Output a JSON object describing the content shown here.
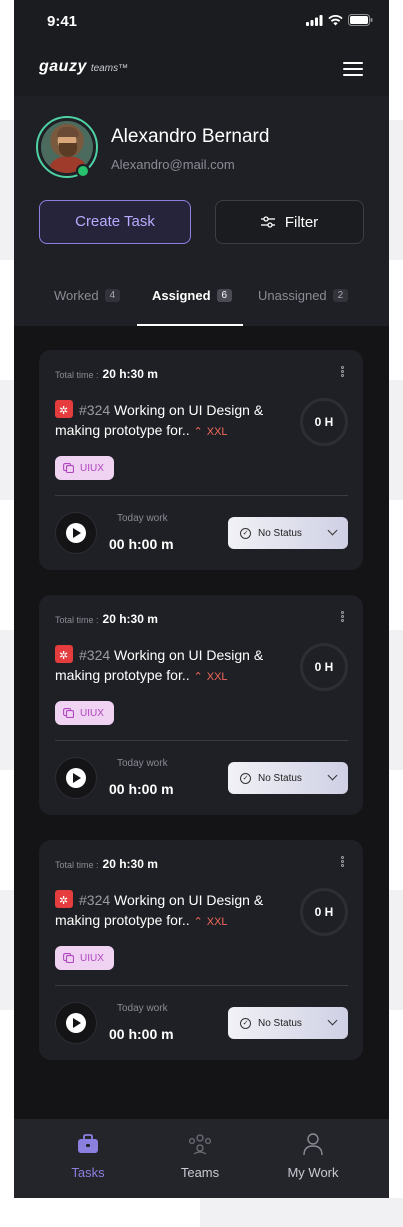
{
  "status_bar": {
    "time": "9:41"
  },
  "app": {
    "logo_main": "gauzy",
    "logo_sub": "teams™"
  },
  "profile": {
    "name": "Alexandro Bernard",
    "email": "Alexandro@mail.com",
    "online": true
  },
  "actions": {
    "create_task": "Create Task",
    "filter": "Filter"
  },
  "tabs": [
    {
      "label": "Worked",
      "count": "4",
      "active": false
    },
    {
      "label": "Assigned",
      "count": "6",
      "active": true
    },
    {
      "label": "Unassigned",
      "count": "2",
      "active": false
    }
  ],
  "tasks": [
    {
      "total_label": "Total time :",
      "total_value": "20 h:30 m",
      "number": "#324",
      "title": "Working on UI Design & making prototype for..",
      "priority": "XXL",
      "hours": "0 H",
      "tag": "UIUX",
      "today_label": "Today work",
      "today_value": "00 h:00 m",
      "status": "No Status"
    },
    {
      "total_label": "Total time :",
      "total_value": "20 h:30 m",
      "number": "#324",
      "title": "Working on UI Design & making prototype for..",
      "priority": "XXL",
      "hours": "0 H",
      "tag": "UIUX",
      "today_label": "Today work",
      "today_value": "00 h:00 m",
      "status": "No Status"
    },
    {
      "total_label": "Total time :",
      "total_value": "20 h:30 m",
      "number": "#324",
      "title": "Working on UI Design & making prototype for..",
      "priority": "XXL",
      "hours": "0 H",
      "tag": "UIUX",
      "today_label": "Today work",
      "today_value": "00 h:00 m",
      "status": "No Status"
    }
  ],
  "bottom_nav": [
    {
      "label": "Tasks",
      "icon": "briefcase-icon",
      "active": true
    },
    {
      "label": "Teams",
      "icon": "people-icon",
      "active": false
    },
    {
      "label": "My Work",
      "icon": "user-icon",
      "active": false
    }
  ],
  "colors": {
    "accent": "#8b7fe0",
    "priority": "#f0685a",
    "bug": "#e53d3d",
    "online": "#27c26b"
  }
}
